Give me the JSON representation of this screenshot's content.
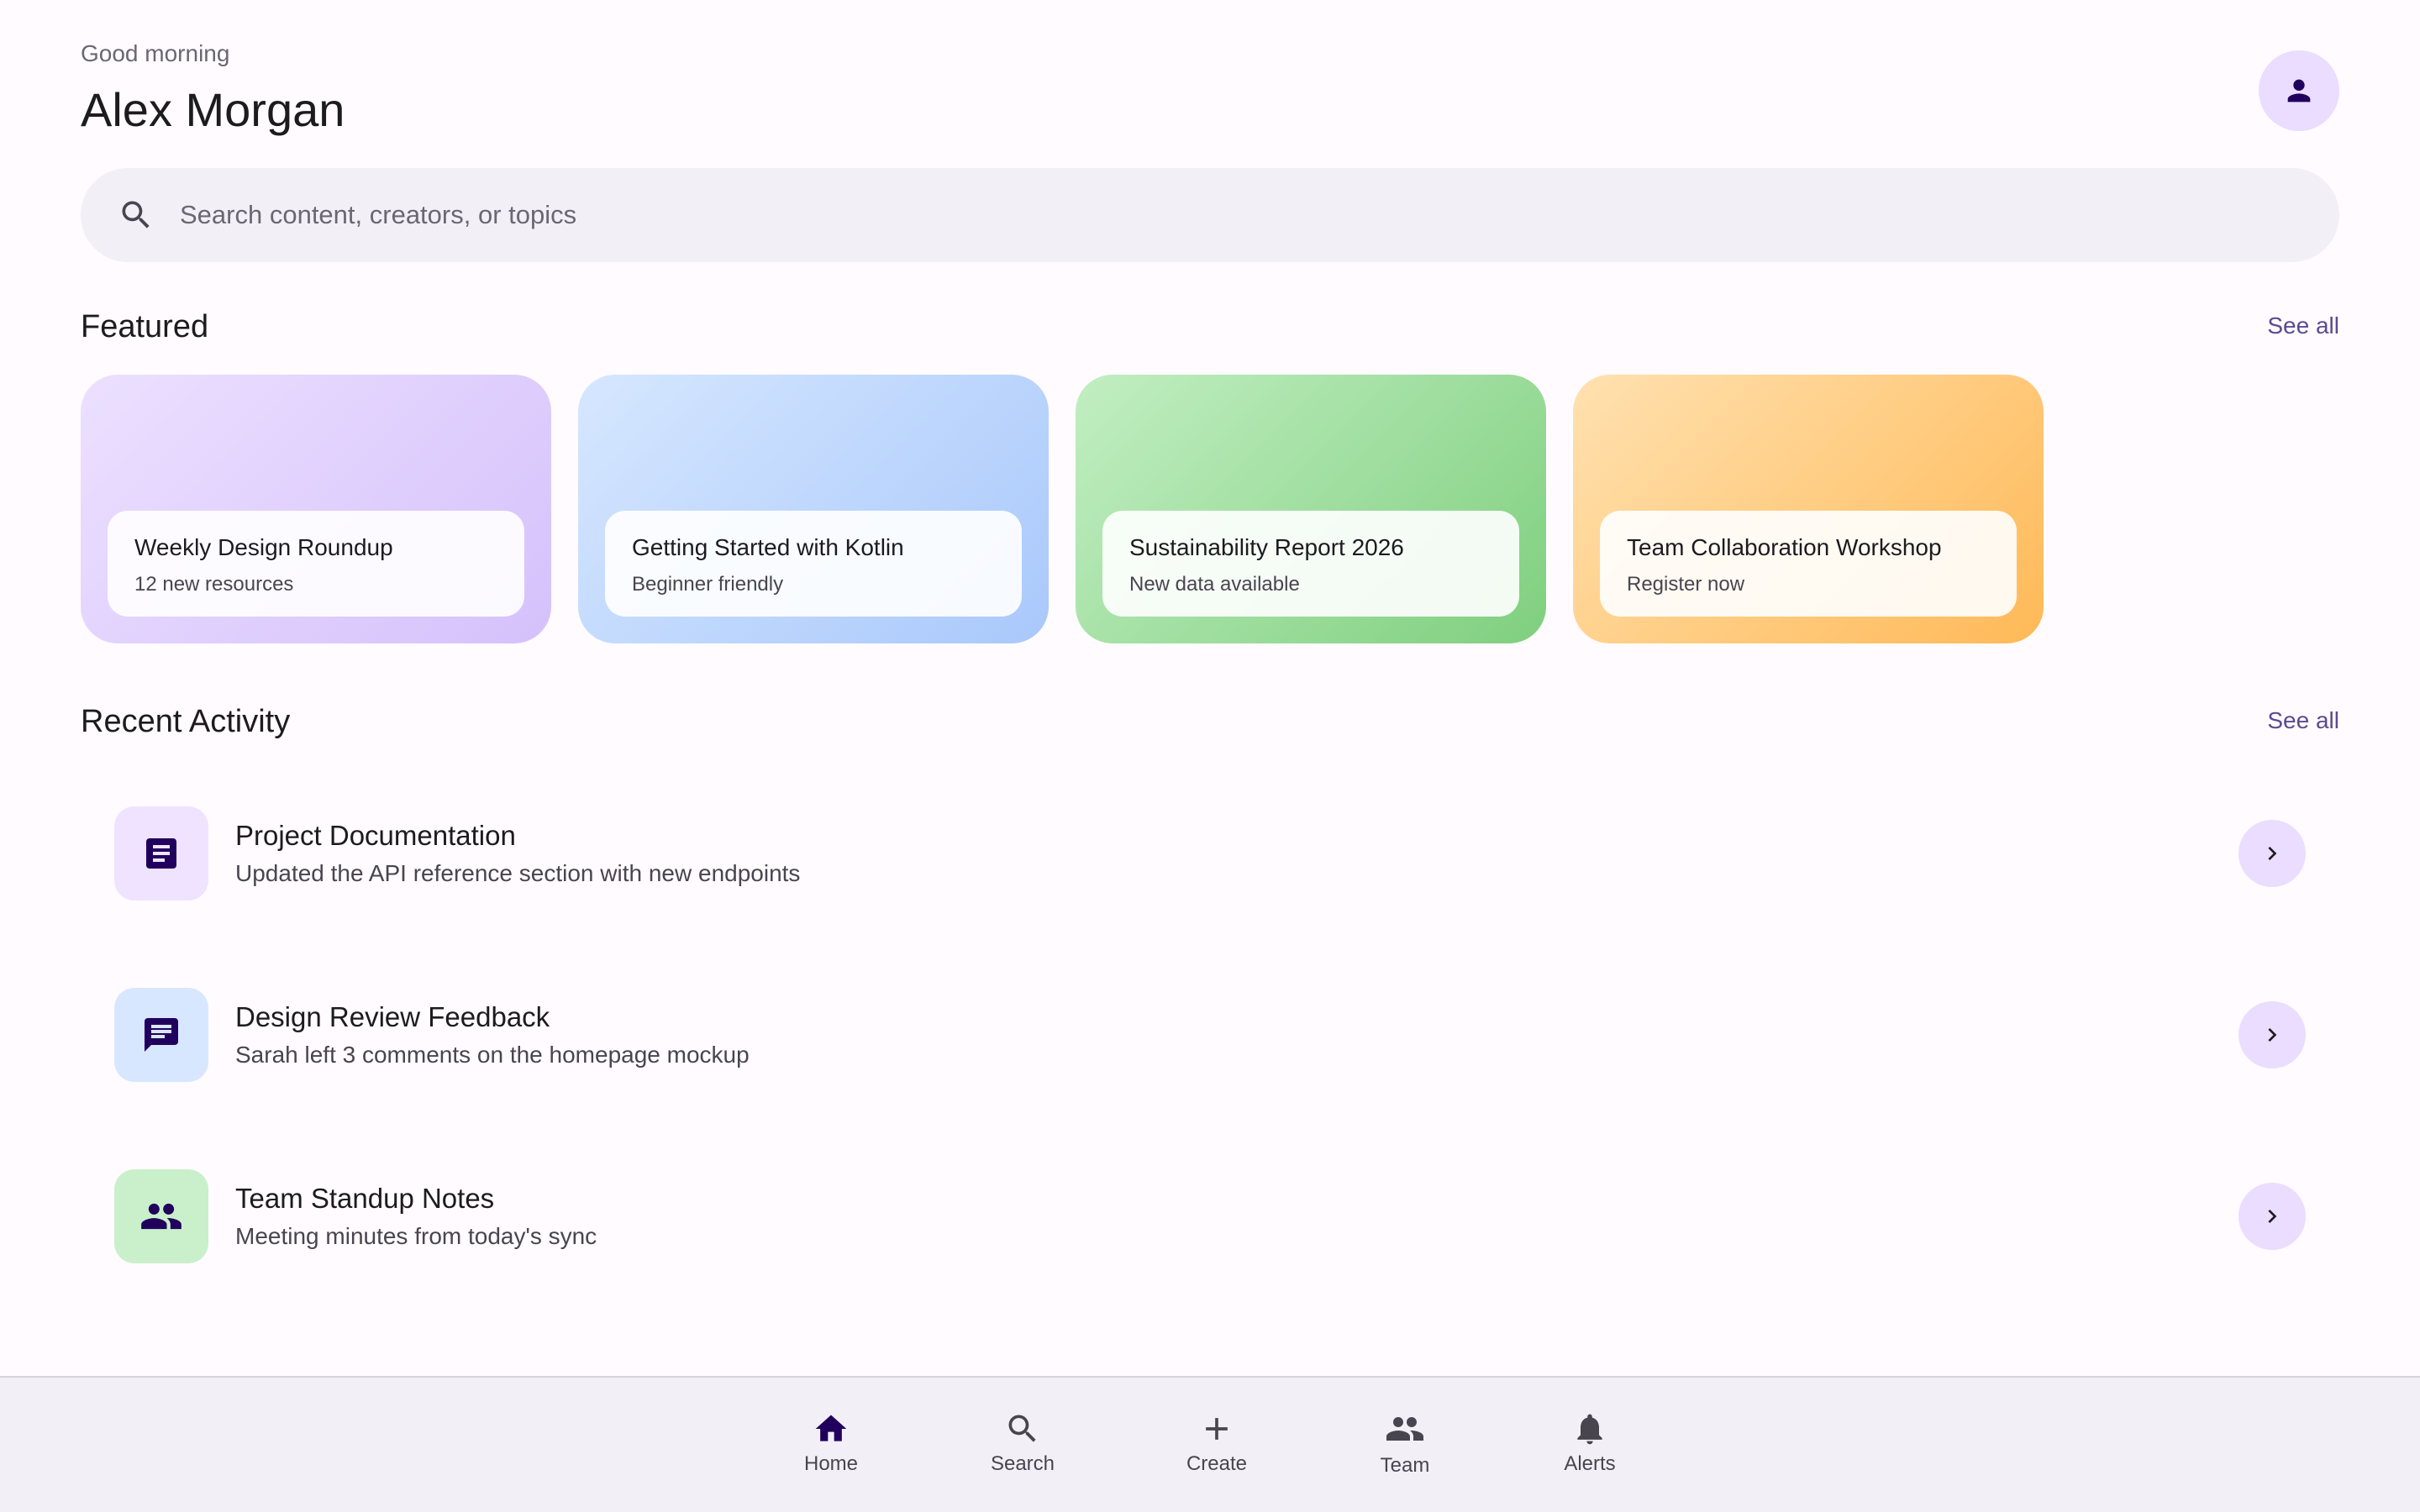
{
  "header": {
    "greeting": "Good morning",
    "user_name": "Alex Morgan",
    "avatar_icon": "person-icon"
  },
  "search": {
    "placeholder": "Search content, creators, or topics",
    "value": ""
  },
  "featured": {
    "title": "Featured",
    "see_all": "See all",
    "cards": [
      {
        "title": "Weekly Design Roundup",
        "subtitle": "12 new resources",
        "colors": [
          "#ece0ff",
          "#d5c1fb"
        ]
      },
      {
        "title": "Getting Started with Kotlin",
        "subtitle": "Beginner friendly",
        "colors": [
          "#d6e7ff",
          "#a9c8fb"
        ]
      },
      {
        "title": "Sustainability Report 2026",
        "subtitle": "New data available",
        "colors": [
          "#c2eec2",
          "#7fcf7f"
        ]
      },
      {
        "title": "Team Collaboration Workshop",
        "subtitle": "Register now",
        "colors": [
          "#ffe1b0",
          "#ffb957"
        ]
      }
    ]
  },
  "recent": {
    "title": "Recent Activity",
    "see_all": "See all",
    "items": [
      {
        "title": "Project Documentation",
        "subtitle": "Updated the API reference section with new endpoints",
        "icon": "document-icon",
        "bg": "#efe3ff"
      },
      {
        "title": "Design Review Feedback",
        "subtitle": "Sarah left 3 comments on the homepage mockup",
        "icon": "comment-icon",
        "bg": "#d7e7ff"
      },
      {
        "title": "Team Standup Notes",
        "subtitle": "Meeting minutes from today's sync",
        "icon": "group-icon",
        "bg": "#c9f0cb"
      }
    ]
  },
  "bottom_nav": {
    "items": [
      {
        "label": "Home",
        "icon": "home-icon",
        "active": true
      },
      {
        "label": "Search",
        "icon": "search-icon",
        "active": false
      },
      {
        "label": "Create",
        "icon": "plus-icon",
        "active": false
      },
      {
        "label": "Team",
        "icon": "group-icon",
        "active": false
      },
      {
        "label": "Alerts",
        "icon": "bell-icon",
        "active": false
      }
    ]
  },
  "colors": {
    "accent": "#5b4a91",
    "avatar_bg": "#eaddff",
    "surface": "#f3eff7",
    "icon_dark": "#21005d"
  }
}
